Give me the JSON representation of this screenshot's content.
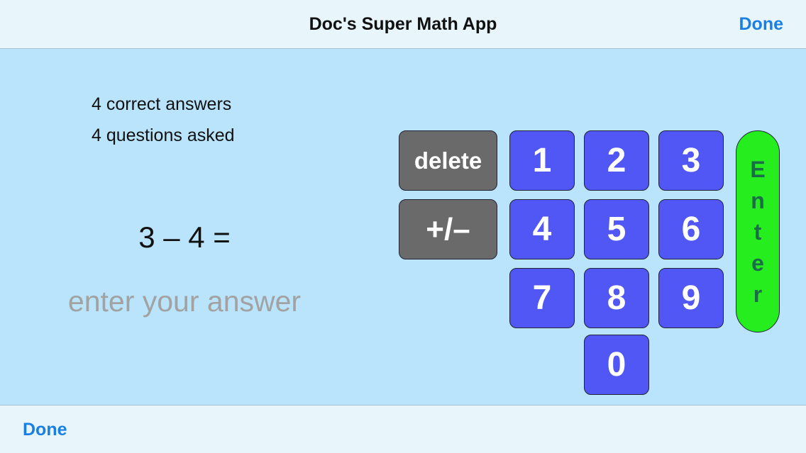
{
  "nav": {
    "title": "Doc's Super Math App",
    "done_label": "Done"
  },
  "stats": {
    "correct": "4 correct answers",
    "asked": "4 questions asked"
  },
  "question": {
    "text": "3 – 4 ="
  },
  "answer": {
    "placeholder": "enter your answer",
    "value": ""
  },
  "keypad": {
    "delete_label": "delete",
    "sign_label": "+/–",
    "digits": [
      "1",
      "2",
      "3",
      "4",
      "5",
      "6",
      "7",
      "8",
      "9",
      "0"
    ],
    "enter_letters": [
      "E",
      "n",
      "t",
      "e",
      "r"
    ]
  },
  "toolbar": {
    "done_label": "Done"
  },
  "colors": {
    "background": "#b9e4fb",
    "bar_background": "#e8f5fb",
    "accent": "#1a7fe3",
    "digit_key": "#5157f4",
    "function_key": "#6a6a6a",
    "enter_key": "#26ee1e",
    "enter_text": "#1b6c49"
  }
}
